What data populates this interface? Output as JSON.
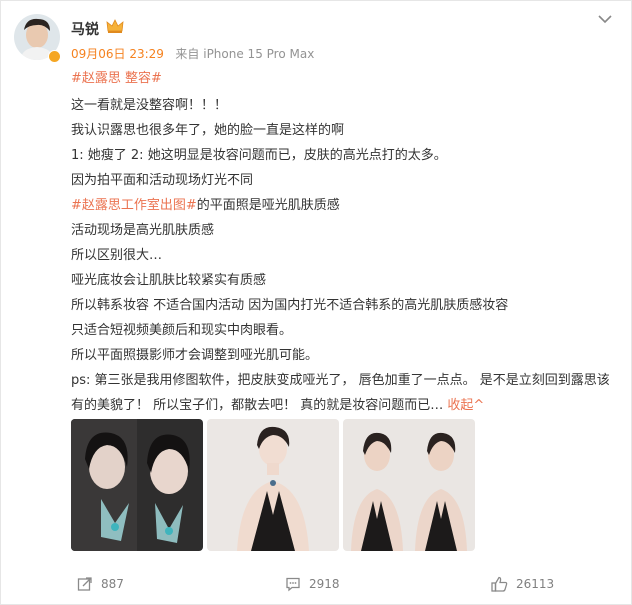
{
  "post": {
    "username": "马锐",
    "meta": {
      "time": "09月06日 23:29",
      "source": "来自 iPhone 15 Pro Max"
    },
    "hashtags": "#赵露思 整容#",
    "lines": [
      "这一看就是没整容啊！！！",
      "我认识露思也很多年了，她的脸一直是这样的啊",
      "1: 她瘦了 2: 她这明显是妆容问题而已，皮肤的高光点打的太多。",
      "因为拍平面和活动现场灯光不同",
      "",
      "活动现场是高光肌肤质感",
      "所以区别很大…",
      "哑光底妆会让肌肤比较紧实有质感",
      "所以韩系妆容 不适合国内活动 因为国内打光不适合韩系的高光肌肤质感妆容",
      "只适合短视频美颜后和现实中肉眼看。",
      "所以平面照摄影师才会调整到哑光肌可能。"
    ],
    "tag_line": {
      "tag": "#赵露思工作室出图#",
      "text": "的平面照是哑光肌肤质感"
    },
    "ps": "ps:   第三张是我用修图软件，把皮肤变成哑光了，  唇色加重了一点点。  是不是立刻回到露思该有的美貌了！ 所以宝子们，都散去吧！  真的就是妆容问题而已…",
    "collapse_label": "收起^"
  },
  "footer": {
    "repost_count": "887",
    "comment_count": "2918",
    "like_count": "26113"
  },
  "icons": {
    "crown": "vip-crown-icon",
    "more": "chevron-down-icon",
    "repost": "repost-icon",
    "comment": "comment-icon",
    "like": "thumbs-up-icon"
  },
  "colors": {
    "accent": "#eb7350",
    "time": "#f5821f",
    "text": "#333333",
    "meta": "#939393"
  }
}
